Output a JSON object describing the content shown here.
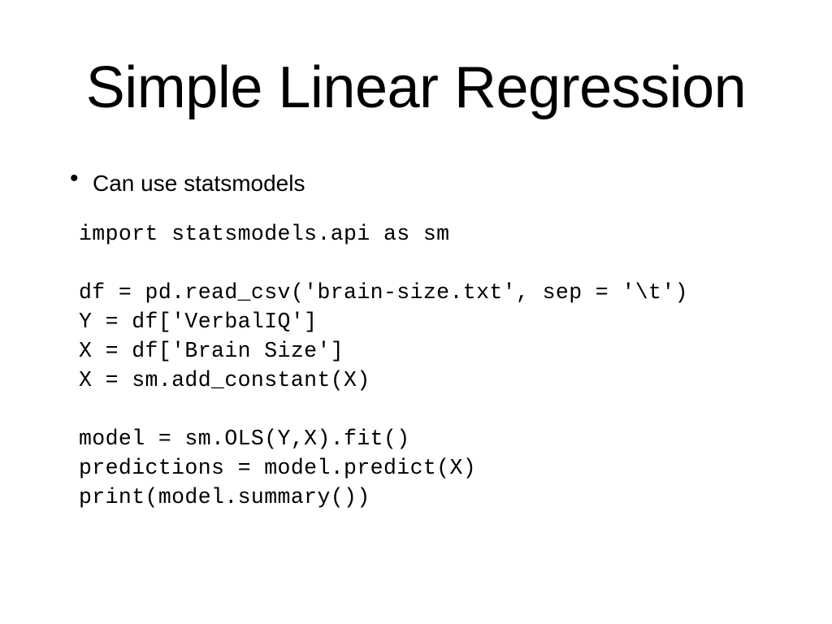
{
  "slide": {
    "title": "Simple Linear Regression",
    "bullets": [
      {
        "marker": "•",
        "text": "Can use statsmodels"
      }
    ],
    "code_lines": [
      "import statsmodels.api as sm",
      "",
      "df = pd.read_csv('brain-size.txt', sep = '\\t')",
      "Y = df['VerbalIQ']",
      "X = df['Brain Size']",
      "X = sm.add_constant(X)",
      "",
      "model = sm.OLS(Y,X).fit()",
      "predictions = model.predict(X)",
      "print(model.summary())"
    ]
  }
}
